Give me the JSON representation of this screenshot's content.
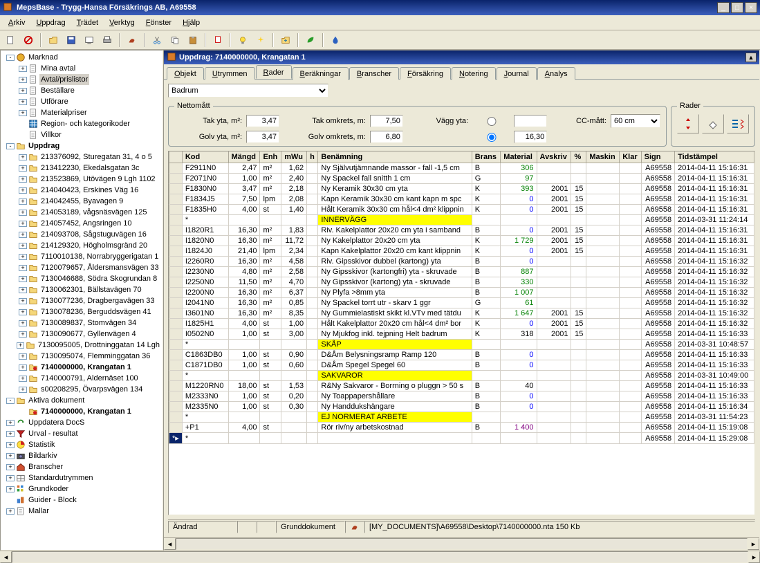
{
  "window": {
    "title": "MepsBase - Trygg-Hansa Försäkrings AB, A69558"
  },
  "menubar": [
    "Arkiv",
    "Uppdrag",
    "Trädet",
    "Verktyg",
    "Fönster",
    "Hjälp"
  ],
  "tree": {
    "nodes": [
      {
        "d": 0,
        "t": "-",
        "i": "globe",
        "label": "Marknad"
      },
      {
        "d": 1,
        "t": "+",
        "i": "doc",
        "label": "Mina avtal"
      },
      {
        "d": 1,
        "t": "+",
        "i": "doc",
        "label": "Avtal/prislistor",
        "selected": true
      },
      {
        "d": 1,
        "t": "+",
        "i": "doc",
        "label": "Beställare"
      },
      {
        "d": 1,
        "t": "+",
        "i": "doc",
        "label": "Utförare"
      },
      {
        "d": 1,
        "t": "+",
        "i": "doc",
        "label": "Materialpriser"
      },
      {
        "d": 1,
        "t": " ",
        "i": "grid",
        "label": "Region- och kategorikoder"
      },
      {
        "d": 1,
        "t": " ",
        "i": "doc",
        "label": "Villkor"
      },
      {
        "d": 0,
        "t": "-",
        "i": "folder",
        "label": "Uppdrag",
        "bold": true
      },
      {
        "d": 1,
        "t": "+",
        "i": "folder",
        "label": "213376092, Sturegatan 31, 4 o 5"
      },
      {
        "d": 1,
        "t": "+",
        "i": "folder",
        "label": "213412230, Ekedalsgatan 3c"
      },
      {
        "d": 1,
        "t": "+",
        "i": "folder",
        "label": "213523869, Utövägen 9 Lgh 1102"
      },
      {
        "d": 1,
        "t": "+",
        "i": "folder",
        "label": "214040423, Erskines Väg 16"
      },
      {
        "d": 1,
        "t": "+",
        "i": "folder",
        "label": "214042455, Byavagen 9"
      },
      {
        "d": 1,
        "t": "+",
        "i": "folder",
        "label": "214053189, vågsnäsvägen 125"
      },
      {
        "d": 1,
        "t": "+",
        "i": "folder",
        "label": "214057452, Angsringen 10"
      },
      {
        "d": 1,
        "t": "+",
        "i": "folder",
        "label": "214093708, Sågstuguvägen 16"
      },
      {
        "d": 1,
        "t": "+",
        "i": "folder",
        "label": "214129320, Högholmsgränd 20"
      },
      {
        "d": 1,
        "t": "+",
        "i": "folder",
        "label": "7110010138, Norrabryggerigatan 1"
      },
      {
        "d": 1,
        "t": "+",
        "i": "folder",
        "label": "7120079657, Åldersmansvägen 33"
      },
      {
        "d": 1,
        "t": "+",
        "i": "folder",
        "label": "7130046688, Södra Skogrundan 8"
      },
      {
        "d": 1,
        "t": "+",
        "i": "folder",
        "label": "7130062301, Bällstavägen 70"
      },
      {
        "d": 1,
        "t": "+",
        "i": "folder",
        "label": "7130077236, Dragbergavägen 33"
      },
      {
        "d": 1,
        "t": "+",
        "i": "folder",
        "label": "7130078236, Berguddsvägen 41"
      },
      {
        "d": 1,
        "t": "+",
        "i": "folder",
        "label": "7130089837, Stomvägen 34"
      },
      {
        "d": 1,
        "t": "+",
        "i": "folder",
        "label": "7130090677, Gyllenvägen 4"
      },
      {
        "d": 1,
        "t": "+",
        "i": "folder",
        "label": "7130095005, Drottninggatan 14 Lgh"
      },
      {
        "d": 1,
        "t": "+",
        "i": "folder",
        "label": "7130095074, Flemminggatan 36"
      },
      {
        "d": 1,
        "t": "+",
        "i": "folder-red",
        "label": "7140000000, Krangatan 1",
        "bold": true
      },
      {
        "d": 1,
        "t": "+",
        "i": "folder",
        "label": "7140000791, Aldernäset 100"
      },
      {
        "d": 1,
        "t": "+",
        "i": "folder",
        "label": "s00208295, Övarpsvägen 134"
      },
      {
        "d": 0,
        "t": "-",
        "i": "folder",
        "label": "Aktiva dokument"
      },
      {
        "d": 1,
        "t": " ",
        "i": "folder-red",
        "label": "7140000000, Krangatan 1",
        "bold": true
      },
      {
        "d": 0,
        "t": "+",
        "i": "refresh",
        "label": "Uppdatera DocS"
      },
      {
        "d": 0,
        "t": "+",
        "i": "funnel",
        "label": "Urval - resultat"
      },
      {
        "d": 0,
        "t": "+",
        "i": "chart",
        "label": "Statistik"
      },
      {
        "d": 0,
        "t": "+",
        "i": "camera",
        "label": "Bildarkiv"
      },
      {
        "d": 0,
        "t": "+",
        "i": "house",
        "label": "Branscher"
      },
      {
        "d": 0,
        "t": "+",
        "i": "rooms",
        "label": "Standardutrymmen"
      },
      {
        "d": 0,
        "t": "+",
        "i": "grid2",
        "label": "Grundkoder"
      },
      {
        "d": 0,
        "t": " ",
        "i": "blocks",
        "label": "Guider - Block"
      },
      {
        "d": 0,
        "t": "+",
        "i": "doc",
        "label": "Mallar"
      }
    ]
  },
  "sub": {
    "title": "Uppdrag: 7140000000, Krangatan 1"
  },
  "tabs": [
    "Objekt",
    "Utrymmen",
    "Rader",
    "Beräkningar",
    "Branscher",
    "Försäkring",
    "Notering",
    "Journal",
    "Analys"
  ],
  "activeTab": "Rader",
  "roomSelect": "Badrum",
  "netto": {
    "legend": "Nettomått",
    "tak_yta_label": "Tak yta, m²:",
    "tak_yta": "3,47",
    "golv_yta_label": "Golv yta, m²:",
    "golv_yta": "3,47",
    "tak_omkrets_label": "Tak omkrets, m:",
    "tak_omkrets": "7,50",
    "golv_omkrets_label": "Golv omkrets, m:",
    "golv_omkrets": "6,80",
    "vagg_yta_label": "Vägg yta:",
    "vagg_yta_alt": "16,30",
    "cc_label": "CC-mått:",
    "cc_value": "60 cm"
  },
  "rader_legend": "Rader",
  "columns": [
    "Kod",
    "Mängd",
    "Enh",
    "mWu",
    "h",
    "Benämning",
    "Brans",
    "Material",
    "Avskriv",
    "%",
    "Maskin",
    "Klar",
    "Sign",
    "Tidstämpel"
  ],
  "rows": [
    {
      "kod": "F2911N0",
      "mangd": "2,47",
      "enh": "m²",
      "mwu": "1,62",
      "h": "",
      "ben": "Ny  Självutjämnande massor - fall -1,5 cm",
      "brans": "B",
      "mat": "306",
      "matc": "green",
      "avs": "",
      "pct": "",
      "sign": "A69558",
      "ts": "2014-04-11 15:16:31"
    },
    {
      "kod": "F2071N0",
      "mangd": "1,00",
      "enh": "m²",
      "mwu": "2,40",
      "h": "",
      "ben": "Ny  Spackel fall snitth 1 cm",
      "brans": "G",
      "mat": "97",
      "matc": "green",
      "avs": "",
      "pct": "",
      "sign": "A69558",
      "ts": "2014-04-11 15:16:31"
    },
    {
      "kod": "F1830N0",
      "mangd": "3,47",
      "enh": "m²",
      "mwu": "2,18",
      "h": "",
      "ben": "Ny  Keramik 30x30 cm yta",
      "brans": "K",
      "mat": "393",
      "matc": "green",
      "avs": "2001",
      "pct": "15",
      "sign": "A69558",
      "ts": "2014-04-11 15:16:31"
    },
    {
      "kod": "F1834J5",
      "mangd": "7,50",
      "enh": "lpm",
      "mwu": "2,08",
      "h": "",
      "ben": "Kapn  Keramik 30x30 cm kant kapn m spc",
      "brans": "K",
      "mat": "0",
      "matc": "blue",
      "avs": "2001",
      "pct": "15",
      "sign": "A69558",
      "ts": "2014-04-11 15:16:31"
    },
    {
      "kod": "F1835H0",
      "mangd": "4,00",
      "enh": "st",
      "mwu": "1,40",
      "h": "",
      "ben": "Hålt  Keramik 30x30 cm hål<4 dm² klippnin",
      "brans": "K",
      "mat": "0",
      "matc": "blue",
      "avs": "2001",
      "pct": "15",
      "sign": "A69558",
      "ts": "2014-04-11 15:16:31"
    },
    {
      "kod": "*",
      "mangd": "",
      "enh": "",
      "mwu": "",
      "h": "",
      "ben": "INNERVÄGG",
      "hl": true,
      "brans": "",
      "mat": "",
      "avs": "",
      "pct": "",
      "sign": "A69558",
      "ts": "2014-03-31 11:24:14"
    },
    {
      "kod": "I1820R1",
      "mangd": "16,30",
      "enh": "m²",
      "mwu": "1,83",
      "h": "",
      "ben": "Riv.  Kakelplattor 20x20 cm yta i samband",
      "brans": "B",
      "mat": "0",
      "matc": "blue",
      "avs": "2001",
      "pct": "15",
      "sign": "A69558",
      "ts": "2014-04-11 15:16:31"
    },
    {
      "kod": "I1820N0",
      "mangd": "16,30",
      "enh": "m²",
      "mwu": "11,72",
      "h": "",
      "ben": "Ny  Kakelplattor 20x20 cm yta",
      "brans": "K",
      "mat": "1 729",
      "matc": "green",
      "avs": "2001",
      "pct": "15",
      "sign": "A69558",
      "ts": "2014-04-11 15:16:31"
    },
    {
      "kod": "I1824J0",
      "mangd": "21,40",
      "enh": "lpm",
      "mwu": "2,34",
      "h": "",
      "ben": "Kapn  Kakelplattor 20x20 cm kant klippnin",
      "brans": "K",
      "mat": "0",
      "matc": "blue",
      "avs": "2001",
      "pct": "15",
      "sign": "A69558",
      "ts": "2014-04-11 15:16:31"
    },
    {
      "kod": "I2260R0",
      "mangd": "16,30",
      "enh": "m²",
      "mwu": "4,58",
      "h": "",
      "ben": "Riv.  Gipsskivor dubbel (kartong) yta",
      "brans": "B",
      "mat": "0",
      "matc": "blue",
      "avs": "",
      "pct": "",
      "sign": "A69558",
      "ts": "2014-04-11 15:16:32"
    },
    {
      "kod": "I2230N0",
      "mangd": "4,80",
      "enh": "m²",
      "mwu": "2,58",
      "h": "",
      "ben": "Ny  Gipsskivor (kartongfri) yta - skruvade",
      "brans": "B",
      "mat": "887",
      "matc": "green",
      "avs": "",
      "pct": "",
      "sign": "A69558",
      "ts": "2014-04-11 15:16:32"
    },
    {
      "kod": "I2250N0",
      "mangd": "11,50",
      "enh": "m²",
      "mwu": "4,70",
      "h": "",
      "ben": "Ny  Gipsskivor (kartong) yta - skruvade",
      "brans": "B",
      "mat": "330",
      "matc": "green",
      "avs": "",
      "pct": "",
      "sign": "A69558",
      "ts": "2014-04-11 15:16:32"
    },
    {
      "kod": "I2200N0",
      "mangd": "16,30",
      "enh": "m²",
      "mwu": "6,37",
      "h": "",
      "ben": "Ny  Plyfa >8mm yta",
      "brans": "B",
      "mat": "1 007",
      "matc": "green",
      "avs": "",
      "pct": "",
      "sign": "A69558",
      "ts": "2014-04-11 15:16:32"
    },
    {
      "kod": "I2041N0",
      "mangd": "16,30",
      "enh": "m²",
      "mwu": "0,85",
      "h": "",
      "ben": "Ny  Spackel torrt utr - skarv 1 ggr",
      "brans": "G",
      "mat": "61",
      "matc": "green",
      "avs": "",
      "pct": "",
      "sign": "A69558",
      "ts": "2014-04-11 15:16:32"
    },
    {
      "kod": "I3601N0",
      "mangd": "16,30",
      "enh": "m²",
      "mwu": "8,35",
      "h": "",
      "ben": "Ny  Gummielastiskt skikt kl.VTv med tätdu",
      "brans": "K",
      "mat": "1 647",
      "matc": "green",
      "avs": "2001",
      "pct": "15",
      "sign": "A69558",
      "ts": "2014-04-11 15:16:32"
    },
    {
      "kod": "I1825H1",
      "mangd": "4,00",
      "enh": "st",
      "mwu": "1,00",
      "h": "",
      "ben": "Hålt  Kakelplattor 20x20 cm hål<4 dm² bor",
      "brans": "K",
      "mat": "0",
      "matc": "blue",
      "avs": "2001",
      "pct": "15",
      "sign": "A69558",
      "ts": "2014-04-11 15:16:32"
    },
    {
      "kod": "I0502N0",
      "mangd": "1,00",
      "enh": "st",
      "mwu": "3,00",
      "h": "",
      "ben": "Ny  Mjukfog inkl. tejpning Helt badrum",
      "brans": "K",
      "mat": "318",
      "matc": "",
      "avs": "2001",
      "pct": "15",
      "sign": "A69558",
      "ts": "2014-04-11 15:16:33"
    },
    {
      "kod": "*",
      "mangd": "",
      "enh": "",
      "mwu": "",
      "h": "",
      "ben": "SKÅP",
      "hl": true,
      "brans": "",
      "mat": "",
      "avs": "",
      "pct": "",
      "sign": "A69558",
      "ts": "2014-03-31 10:48:57"
    },
    {
      "kod": "C1863DB0",
      "mangd": "1,00",
      "enh": "st",
      "mwu": "0,90",
      "h": "",
      "ben": "D&Åm  Belysningsramp Ramp 120",
      "brans": "B",
      "mat": "0",
      "matc": "blue",
      "avs": "",
      "pct": "",
      "sign": "A69558",
      "ts": "2014-04-11 15:16:33"
    },
    {
      "kod": "C1871DB0",
      "mangd": "1,00",
      "enh": "st",
      "mwu": "0,60",
      "h": "",
      "ben": "D&Åm  Spegel Spegel 60",
      "brans": "B",
      "mat": "0",
      "matc": "blue",
      "avs": "",
      "pct": "",
      "sign": "A69558",
      "ts": "2014-04-11 15:16:33"
    },
    {
      "kod": "*",
      "mangd": "",
      "enh": "",
      "mwu": "",
      "h": "",
      "ben": "SAKVAROR",
      "hl": true,
      "brans": "",
      "mat": "",
      "avs": "",
      "pct": "",
      "sign": "A69558",
      "ts": "2014-03-31 10:49:00"
    },
    {
      "kod": "M1220RN0",
      "mangd": "18,00",
      "enh": "st",
      "mwu": "1,53",
      "h": "",
      "ben": "R&Ny  Sakvaror - Borrning o pluggn > 50 s",
      "brans": "B",
      "mat": "40",
      "matc": "",
      "avs": "",
      "pct": "",
      "sign": "A69558",
      "ts": "2014-04-11 15:16:33"
    },
    {
      "kod": "M2333N0",
      "mangd": "1,00",
      "enh": "st",
      "mwu": "0,20",
      "h": "",
      "ben": "Ny  Toappapershållare",
      "brans": "B",
      "mat": "0",
      "matc": "blue",
      "avs": "",
      "pct": "",
      "sign": "A69558",
      "ts": "2014-04-11 15:16:33"
    },
    {
      "kod": "M2335N0",
      "mangd": "1,00",
      "enh": "st",
      "mwu": "0,30",
      "h": "",
      "ben": "Ny  Handdukshängare",
      "brans": "B",
      "mat": "0",
      "matc": "blue",
      "avs": "",
      "pct": "",
      "sign": "A69558",
      "ts": "2014-04-11 15:16:34"
    },
    {
      "kod": "*",
      "mangd": "",
      "enh": "",
      "mwu": "",
      "h": "",
      "ben": "EJ NORMERAT ARBETE",
      "hl": true,
      "brans": "",
      "mat": "",
      "avs": "",
      "pct": "",
      "sign": "A69558",
      "ts": "2014-03-31 11:54:23"
    },
    {
      "kod": "+P1",
      "mangd": "4,00",
      "enh": "st",
      "mwu": "",
      "h": "",
      "ben": "Rör riv/ny arbetskostnad",
      "brans": "B",
      "mat": "1 400",
      "matc": "purple",
      "avs": "",
      "pct": "",
      "sign": "A69558",
      "ts": "2014-04-11 15:19:08"
    },
    {
      "kod": "*",
      "mangd": "",
      "enh": "",
      "mwu": "",
      "h": "",
      "ben": "",
      "brans": "",
      "mat": "",
      "avs": "",
      "pct": "",
      "sign": "A69558",
      "ts": "2014-04-11 15:29:08",
      "last": true
    }
  ],
  "status": {
    "c1": "Ändrad",
    "c2": "Grunddokument",
    "c3": "[MY_DOCUMENTS]\\A69558\\Desktop\\7140000000.nta  150 Kb"
  }
}
